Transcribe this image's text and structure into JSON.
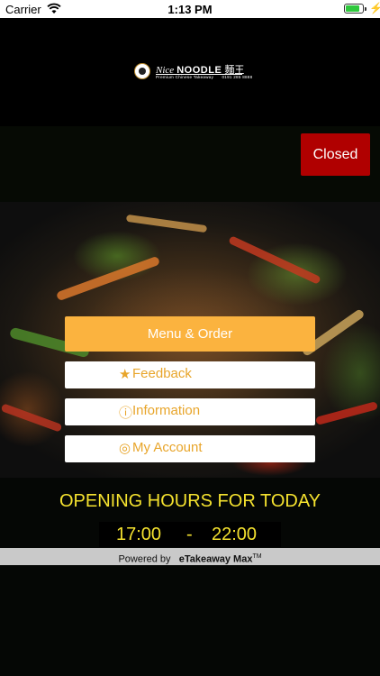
{
  "status_bar": {
    "carrier": "Carrier",
    "time": "1:13 PM",
    "battery_level": 0.85,
    "wifi_icon": "wifi-icon",
    "charging_icon": "bolt-icon"
  },
  "logo": {
    "script": "Nice",
    "brand": "NOODLE",
    "chinese": "麵王",
    "tagline": "Premium Chinese Takeaway",
    "phone": "0191 285 8888"
  },
  "status_button": {
    "label": "Closed",
    "color": "#b00000"
  },
  "actions": {
    "menu_order": "Menu & Order",
    "feedback": {
      "icon": "★",
      "label": "Feedback",
      "icon_name": "star-icon"
    },
    "information": {
      "icon": "ⓘ",
      "label": "Information",
      "icon_name": "info-icon"
    },
    "account": {
      "icon": "◎",
      "label": "My Account",
      "icon_name": "account-icon"
    }
  },
  "opening_hours": {
    "title": "OPENING HOURS FOR TODAY",
    "open": "17:00",
    "separator": "-",
    "close": "22:00"
  },
  "footer": {
    "powered_prefix": "Powered by",
    "product": "eTakeaway Max",
    "trademark": "TM"
  },
  "colors": {
    "accent_orange": "#fbb33f",
    "hours_yellow": "#f5e22f",
    "closed_red": "#b00000"
  }
}
